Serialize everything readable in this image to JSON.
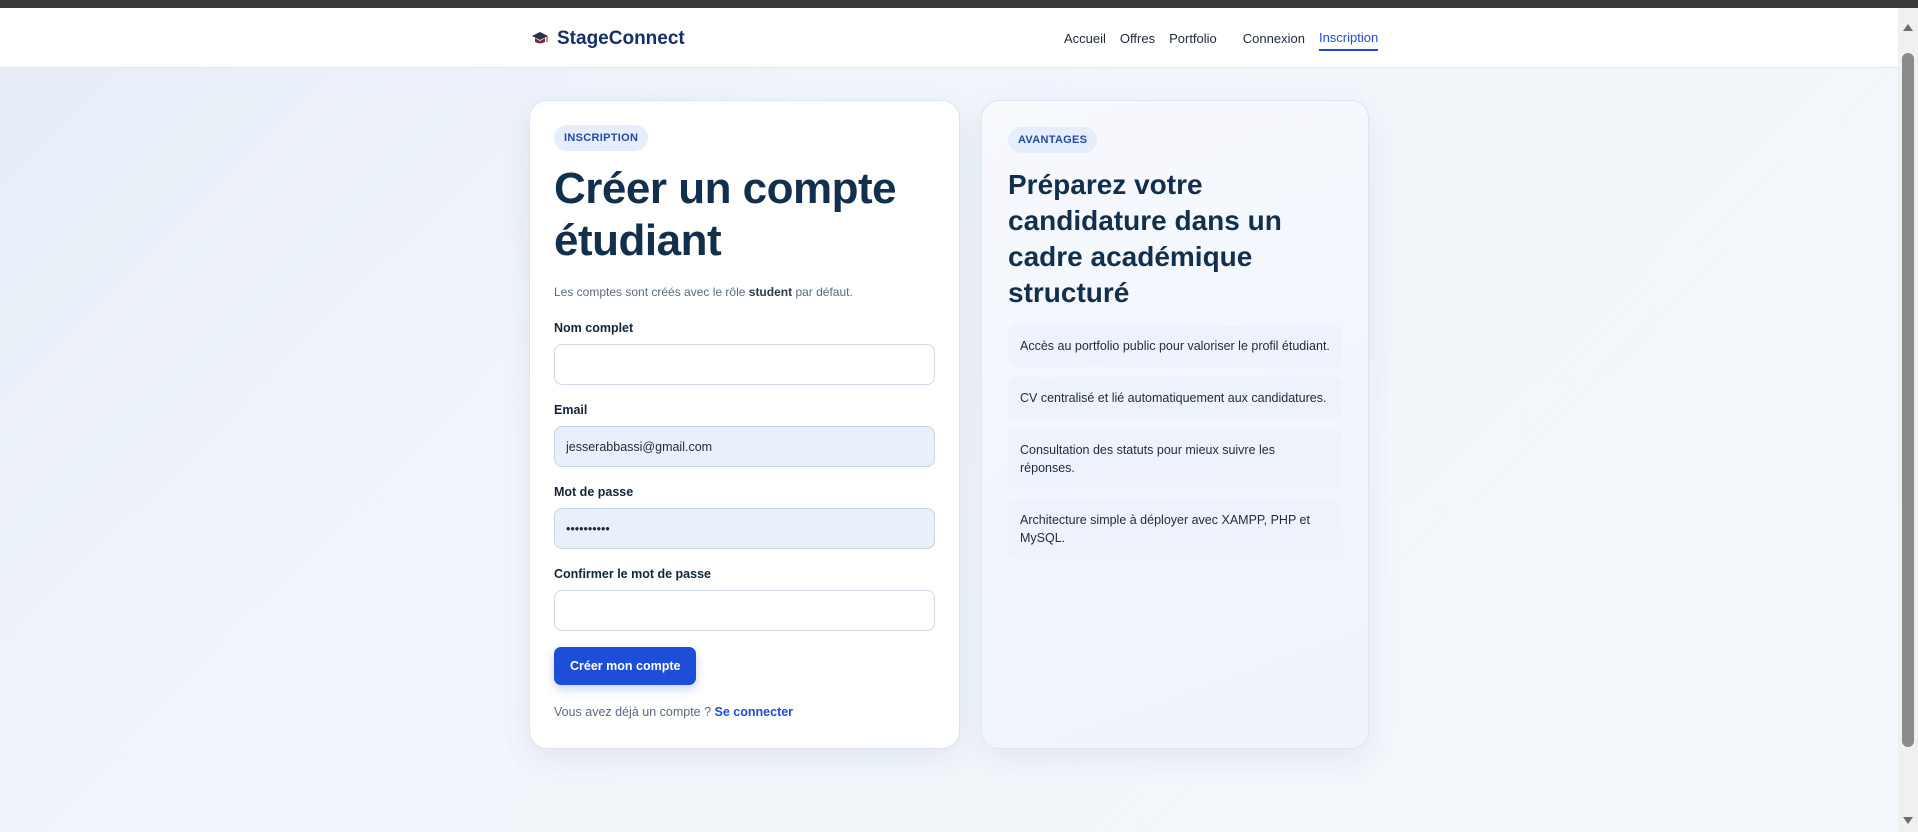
{
  "brand": {
    "name": "StageConnect",
    "icon": "graduation-cap-icon"
  },
  "nav": {
    "items": [
      {
        "label": "Accueil"
      },
      {
        "label": "Offres"
      },
      {
        "label": "Portfolio"
      },
      {
        "label": "Connexion"
      },
      {
        "label": "Inscription",
        "active": true
      }
    ]
  },
  "form_card": {
    "badge": "INSCRIPTION",
    "title": "Créer un compte étudiant",
    "subtitle_before": "Les comptes sont créés avec le rôle ",
    "subtitle_bold": "student",
    "subtitle_after": " par défaut.",
    "fields": {
      "name": {
        "label": "Nom complet",
        "value": ""
      },
      "email": {
        "label": "Email",
        "value": "jesserabbassi@gmail.com"
      },
      "password": {
        "label": "Mot de passe",
        "value": "••••••••••"
      },
      "confirm": {
        "label": "Confirmer le mot de passe",
        "value": ""
      }
    },
    "submit_label": "Créer mon compte",
    "login_prompt": "Vous avez déjà un compte ?",
    "login_link": "Se connecter"
  },
  "benefits_card": {
    "badge": "AVANTAGES",
    "title": "Préparez votre candidature dans un cadre académique structuré",
    "items": [
      "Accès au portfolio public pour valoriser le profil étudiant.",
      "CV centralisé et lié automatiquement aux candidatures.",
      "Consultation des statuts pour mieux suivre les réponses.",
      "Architecture simple à déployer avec XAMPP, PHP et MySQL."
    ]
  },
  "colors": {
    "accent": "#1d4ed8",
    "heading": "#12304d",
    "input_filled": "#e8f0fc"
  }
}
